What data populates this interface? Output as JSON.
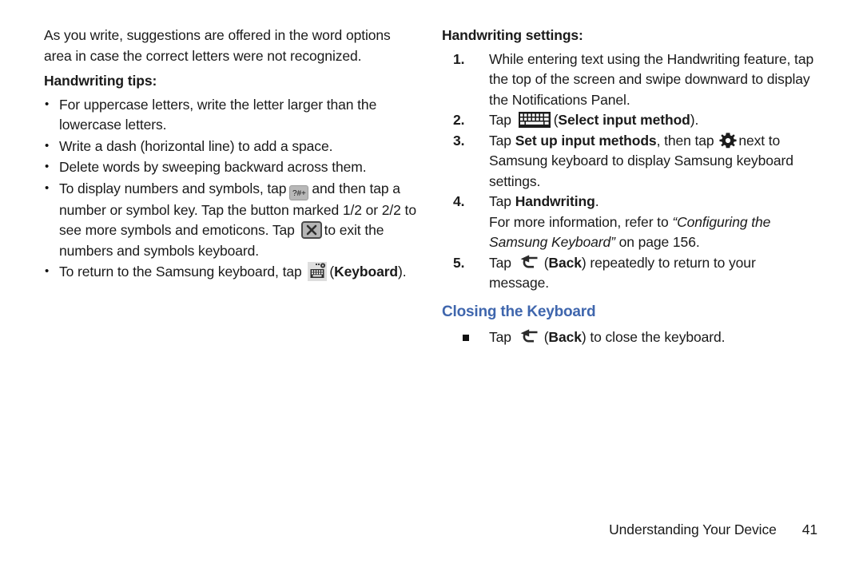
{
  "document": {
    "left_column": {
      "intro_paragraph": "As you write, suggestions are offered in the word options area in case the correct letters were not recognized.",
      "tips_heading": "Handwriting tips:",
      "tips": [
        {
          "id": "tip-uppercase",
          "text": "For uppercase letters, write the letter larger than the lowercase letters."
        },
        {
          "id": "tip-dash",
          "text": "Write a dash (horizontal line) to add a space."
        },
        {
          "id": "tip-delete",
          "text": "Delete words by sweeping backward across them."
        },
        {
          "id": "tip-numbers-symbols",
          "part1": "To display numbers and symbols, tap",
          "icon1": "symbols-key-icon",
          "icon1_label": "?#+",
          "part2": "and then tap a number or symbol key. Tap the button marked 1/2 or 2/2 to see more symbols and emoticons. Tap",
          "icon2": "close-key-icon",
          "part3": "to exit the numbers and symbols keyboard."
        },
        {
          "id": "tip-return-keyboard",
          "part1": "To return to the Samsung keyboard, tap",
          "icon1": "keyboard-settings-icon",
          "part2": "(",
          "bold": "Keyboard",
          "part3": ")."
        }
      ]
    },
    "right_column": {
      "settings_heading": "Handwriting settings:",
      "steps": [
        {
          "number": "1.",
          "text": "While entering text using the Handwriting feature, tap the top of the screen and swipe downward to display the Notifications Panel."
        },
        {
          "number": "2.",
          "pre": "Tap",
          "icon": "select-input-method-keyboard-icon",
          "mid": "(",
          "bold": "Select input method",
          "post": ")."
        },
        {
          "number": "3.",
          "pre": "Tap",
          "bold": "Set up input methods",
          "mid": ", then tap",
          "icon": "gear-icon",
          "post": "next to Samsung keyboard to display Samsung keyboard settings."
        },
        {
          "number": "4.",
          "pre": "Tap",
          "bold": "Handwriting",
          "post": ".",
          "note_pre": "For more information, refer to",
          "note_italic": "“Configuring the Samsung Keyboard”",
          "note_post": "on page 156."
        },
        {
          "number": "5.",
          "pre": "Tap",
          "icon": "back-arrow-icon",
          "mid": "(",
          "bold": "Back",
          "post": ") repeatedly to return to your message."
        }
      ],
      "closing_heading": "Closing the Keyboard",
      "closing_bullet": {
        "pre": "Tap",
        "icon": "back-arrow-icon",
        "mid": "(",
        "bold": "Back",
        "post": ") to close the keyboard."
      }
    },
    "footer": {
      "section_title": "Understanding Your Device",
      "page_number": "41"
    },
    "colors": {
      "heading_blue": "#3f66ad",
      "body_text": "#1a1a1a",
      "key_gray": "#b8b8b8"
    }
  }
}
